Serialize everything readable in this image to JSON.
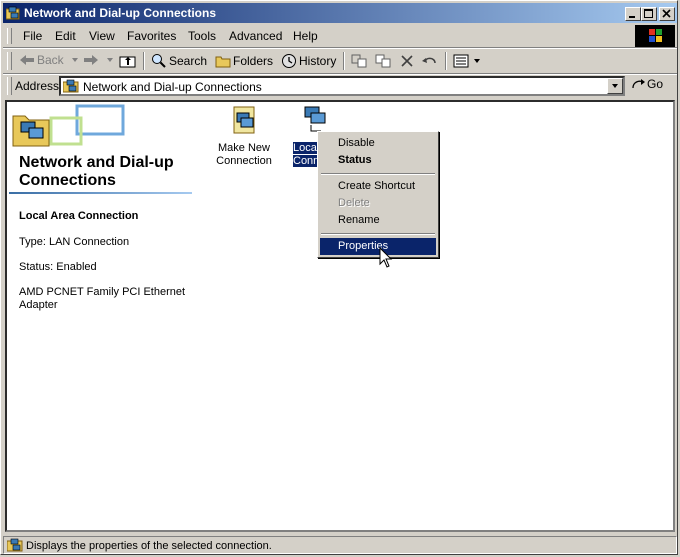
{
  "window": {
    "title": "Network and Dial-up Connections"
  },
  "menubar": {
    "items": [
      "File",
      "Edit",
      "View",
      "Favorites",
      "Tools",
      "Advanced",
      "Help"
    ]
  },
  "toolbar": {
    "back": "Back",
    "search": "Search",
    "folders": "Folders",
    "history": "History"
  },
  "address": {
    "label": "Address",
    "value": "Network and Dial-up Connections",
    "go": "Go"
  },
  "panel": {
    "title": "Network and Dial-up Connections",
    "selected_name": "Local Area Connection",
    "type": "Type: LAN Connection",
    "status": "Status: Enabled",
    "adapter": "AMD PCNET Family PCI Ethernet Adapter"
  },
  "icons": [
    {
      "label": "Make New Connection",
      "line1": "Make New",
      "line2": "Connection"
    },
    {
      "label": "Local Area Connection",
      "line1": "Local",
      "line2": "Conne"
    }
  ],
  "context_menu": {
    "disable": "Disable",
    "status": "Status",
    "create_shortcut": "Create Shortcut",
    "delete": "Delete",
    "rename": "Rename",
    "properties": "Properties"
  },
  "statusbar": {
    "text": "Displays the properties of the selected connection."
  },
  "colors": {
    "title_active": "#0a246a",
    "title_gradient_end": "#a6caf0",
    "face": "#d4d0c8",
    "highlight": "#0a246a"
  }
}
